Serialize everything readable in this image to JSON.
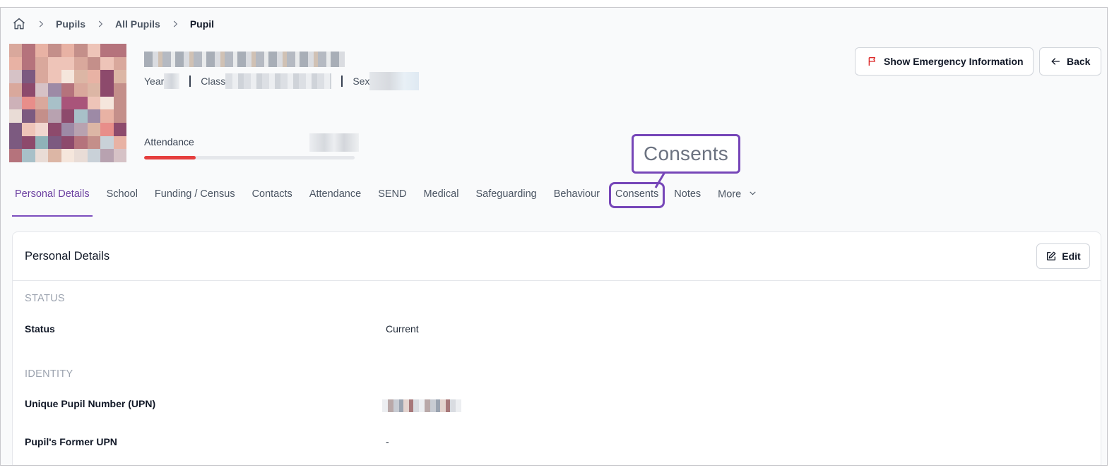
{
  "breadcrumb": {
    "items": [
      "Pupils",
      "All Pupils",
      "Pupil"
    ]
  },
  "header": {
    "year_label": "Year",
    "class_label": "Class",
    "sex_label": "Sex",
    "attendance_label": "Attendance",
    "attendance_fraction": 0.245
  },
  "actions": {
    "emergency_label": "Show Emergency Information",
    "back_label": "Back"
  },
  "tabs": [
    {
      "label": "Personal Details",
      "active": true
    },
    {
      "label": "School"
    },
    {
      "label": "Funding / Census"
    },
    {
      "label": "Contacts"
    },
    {
      "label": "Attendance"
    },
    {
      "label": "SEND"
    },
    {
      "label": "Medical"
    },
    {
      "label": "Safeguarding"
    },
    {
      "label": "Behaviour"
    },
    {
      "label": "Consents",
      "highlighted": true
    },
    {
      "label": "Notes"
    },
    {
      "label": "More"
    }
  ],
  "callout": {
    "text": "Consents"
  },
  "card": {
    "title": "Personal Details",
    "edit_label": "Edit",
    "sections": [
      {
        "heading": "STATUS",
        "fields": [
          {
            "label": "Status",
            "value": "Current"
          }
        ]
      },
      {
        "heading": "IDENTITY",
        "fields": [
          {
            "label": "Unique Pupil Number (UPN)",
            "value": ""
          },
          {
            "label": "Pupil's Former UPN",
            "value": "-"
          }
        ]
      }
    ]
  },
  "colors": {
    "accent": "#7646b8",
    "active_tab": "#6b3fa0",
    "attendance_bar": "#e53e3e",
    "flag_icon": "#dc2626"
  },
  "icons": {
    "home": "home-icon",
    "chevron": "chevron-right-icon",
    "flag": "flag-icon",
    "back": "arrow-left-icon",
    "edit": "edit-icon",
    "more": "chevron-down-icon"
  }
}
